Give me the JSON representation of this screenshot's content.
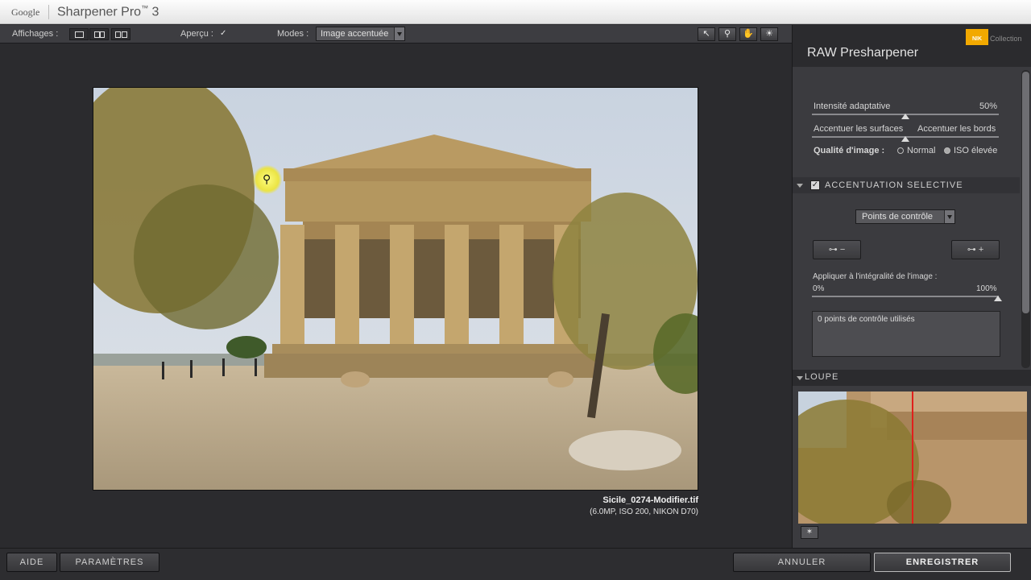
{
  "titlebar": {
    "brand": "Google",
    "app_name": "Sharpener Pro",
    "app_tm": "™",
    "app_version": "3"
  },
  "toolbar": {
    "views_label": "Affichages :",
    "preview_label": "Aperçu :",
    "preview_checked": "✓",
    "modes_label": "Modes :",
    "mode_value": "Image accentuée",
    "tool_icons": [
      "arrow-icon",
      "zoom-icon",
      "hand-icon",
      "light-icon"
    ]
  },
  "image": {
    "filename": "Sicile_0274-Modifier.tif",
    "info": "(6.0MP, ISO 200, NIKON D70)"
  },
  "panel": {
    "logo_text": "NIK",
    "logo_collection": "Collection",
    "title": "RAW Presharpener",
    "adaptive_label": "Intensité adaptative",
    "adaptive_value": "50%",
    "adaptive_level": 0.5,
    "surfaces_label": "Accentuer les surfaces",
    "edges_label": "Accentuer les bords",
    "balance_level": 0.5,
    "quality_label": "Qualité d'image :",
    "quality_normal": "Normal",
    "quality_iso": "ISO élevée",
    "selective_title": "ACCENTUATION SELECTIVE",
    "selective_checked": "✓",
    "cp_dropdown": "Points de contrôle",
    "cp_minus": "−",
    "cp_plus": "+",
    "apply_label": "Appliquer à l'intégralité de l'image :",
    "apply_min": "0%",
    "apply_max": "100%",
    "apply_level": 1.0,
    "cp_used": "0 points de contrôle utilisés",
    "loupe_title": "LOUPE",
    "pin_icon": "pin-icon"
  },
  "bottom": {
    "help": "AIDE",
    "settings": "PARAMÈTRES",
    "cancel": "ANNULER",
    "save": "ENREGISTRER"
  }
}
